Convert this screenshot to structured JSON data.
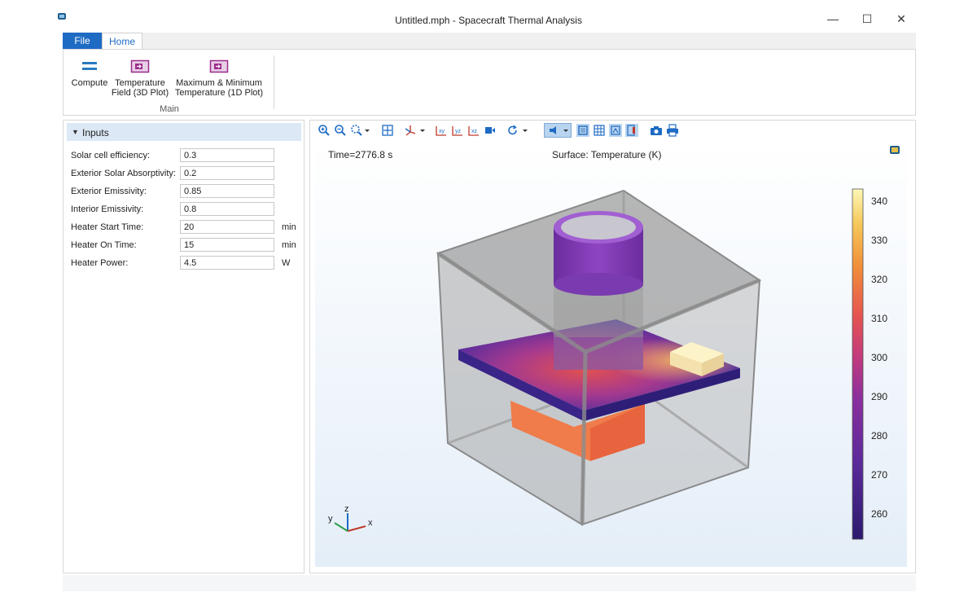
{
  "window": {
    "title": "Untitled.mph - Spacecraft Thermal Analysis",
    "minimize_glyph": "—",
    "maximize_glyph": "☐",
    "close_glyph": "✕"
  },
  "ribbon": {
    "tabs": [
      "File",
      "Home"
    ],
    "buttons": {
      "compute": "Compute",
      "temp_field_1": "Temperature",
      "temp_field_2": "Field (3D Plot)",
      "maxmin_1": "Maximum & Minimum",
      "maxmin_2": "Temperature (1D Plot)"
    },
    "group_label": "Main"
  },
  "inputs": {
    "header": "Inputs",
    "fields": [
      {
        "label": "Solar cell efficiency:",
        "value": "0.3",
        "unit": ""
      },
      {
        "label": "Exterior Solar Absorptivity:",
        "value": "0.2",
        "unit": ""
      },
      {
        "label": "Exterior Emissivity:",
        "value": "0.85",
        "unit": ""
      },
      {
        "label": "Interior Emissivity:",
        "value": "0.8",
        "unit": ""
      },
      {
        "label": "Heater Start Time:",
        "value": "20",
        "unit": "min"
      },
      {
        "label": "Heater On Time:",
        "value": "15",
        "unit": "min"
      },
      {
        "label": "Heater Power:",
        "value": "4.5",
        "unit": "W"
      }
    ]
  },
  "graphics": {
    "time_label": "Time=2776.8 s",
    "surface_label": "Surface: Temperature (K)",
    "colorbar_ticks": [
      "340",
      "330",
      "320",
      "310",
      "300",
      "290",
      "280",
      "270",
      "260"
    ],
    "axes": {
      "z": "z",
      "y": "y",
      "x": "x"
    },
    "colors": {
      "accent": "#1e6bc4",
      "plot_icon": "#9b2a8c",
      "hot": "#fcf7b8",
      "cold": "#2c1a6e"
    }
  }
}
